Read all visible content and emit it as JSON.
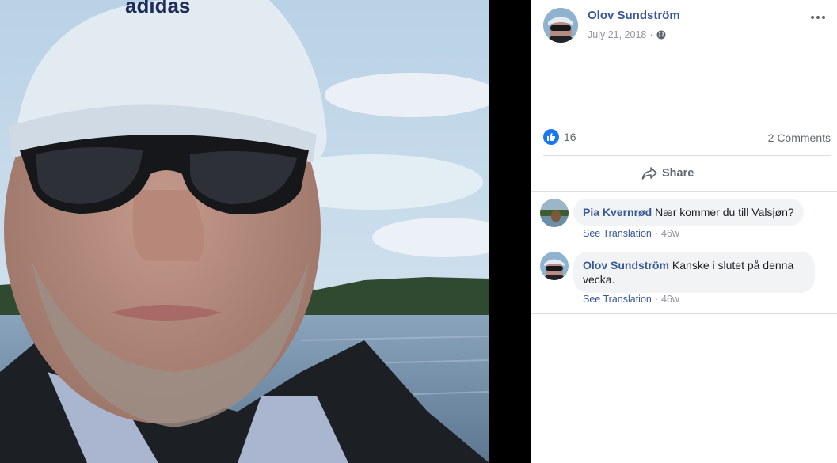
{
  "photo": {
    "cap_text": "adidas"
  },
  "post": {
    "author": "Olov Sundström",
    "date": "July 21, 2018",
    "separator": "·",
    "privacy_icon": "globe-icon",
    "more_icon": "more-horizontal-icon"
  },
  "reactions": {
    "icon": "like-icon",
    "count": "16",
    "comments_label": "2 Comments"
  },
  "actions": {
    "share_label": "Share",
    "share_icon": "share-arrow-icon"
  },
  "comments": [
    {
      "author": "Pia Kvernrød",
      "text": "Nær kommer du till Valsjøn?",
      "see_translation": "See Translation",
      "time": "46w"
    },
    {
      "author": "Olov Sundström",
      "text_line1": "Kanske i slutet på denna",
      "text_line2": "vecka.",
      "see_translation": "See Translation",
      "time": "46w"
    }
  ],
  "colors": {
    "link": "#385898",
    "meta": "#90949c",
    "like_blue": "#1877f2",
    "bubble": "#f2f3f5"
  }
}
